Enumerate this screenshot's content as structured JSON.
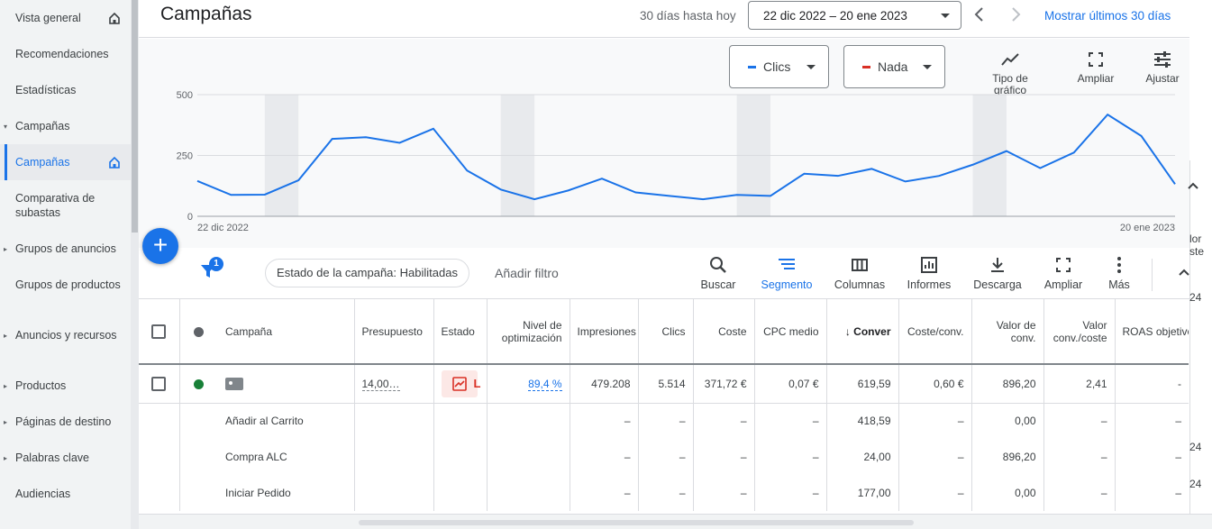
{
  "sidebar": {
    "items": [
      {
        "label": "Vista general",
        "caret": false,
        "home": true,
        "active": false
      },
      {
        "label": "Recomendaciones",
        "caret": false,
        "home": false,
        "active": false
      },
      {
        "label": "Estadísticas",
        "caret": false,
        "home": false,
        "active": false
      },
      {
        "label": "Campañas",
        "caret": true,
        "caret_open": true,
        "home": false,
        "active": false
      },
      {
        "label": "Campañas",
        "caret": false,
        "home": true,
        "active": true
      },
      {
        "label": "Comparativa de subastas",
        "caret": false,
        "home": false,
        "active": false
      },
      {
        "label": "Grupos de anuncios",
        "caret": true,
        "home": false,
        "active": false
      },
      {
        "label": "Grupos de productos",
        "caret": false,
        "home": false,
        "active": false
      },
      {
        "label": "Anuncios y recursos",
        "caret": true,
        "home": false,
        "active": false
      },
      {
        "label": "Productos",
        "caret": true,
        "home": false,
        "active": false
      },
      {
        "label": "Páginas de destino",
        "caret": true,
        "home": false,
        "active": false
      },
      {
        "label": "Palabras clave",
        "caret": true,
        "home": false,
        "active": false
      },
      {
        "label": "Audiencias",
        "caret": false,
        "home": false,
        "active": false
      }
    ]
  },
  "header": {
    "title": "Campañas",
    "date_prefix": "30 días hasta hoy",
    "date_range": "22 dic 2022 – 20 ene 2023",
    "show_last": "Mostrar últimos 30 días",
    "show_last_clip": "g"
  },
  "chart_controls": {
    "metric1": "Clics",
    "metric1_color": "#1a73e8",
    "metric2": "Nada",
    "metric2_color": "#d93025",
    "chart_type_label": "Tipo de gráfico",
    "expand_label": "Ampliar",
    "adjust_label": "Ajustar"
  },
  "chart_data": {
    "type": "line",
    "x_start_label": "22 dic 2022",
    "x_end_label": "20 ene 2023",
    "y_ticks": [
      "500",
      "250",
      "0"
    ],
    "ylim": [
      0,
      500
    ],
    "grid": true,
    "weekend_bands": true,
    "series": [
      {
        "color": "#1a73e8",
        "values": [
          145,
          88,
          89,
          148,
          318,
          325,
          302,
          360,
          188,
          110,
          70,
          106,
          155,
          98,
          84,
          70,
          88,
          84,
          175,
          166,
          195,
          143,
          166,
          212,
          268,
          198,
          262,
          418,
          330,
          132
        ]
      }
    ]
  },
  "filter_bar": {
    "fab_label": "+",
    "filter_count": "1",
    "status_chip": "Estado de la campaña: Habilitadas",
    "add_filter": "Añadir filtro",
    "tools": [
      {
        "label": "Buscar",
        "icon": "search-icon",
        "active": false
      },
      {
        "label": "Segmento",
        "icon": "segment-icon",
        "active": true
      },
      {
        "label": "Columnas",
        "icon": "columns-icon",
        "active": false
      },
      {
        "label": "Informes",
        "icon": "reports-icon",
        "active": false
      },
      {
        "label": "Descarga",
        "icon": "download-icon",
        "active": false
      },
      {
        "label": "Ampliar",
        "icon": "expand-icon",
        "active": false
      },
      {
        "label": "Más",
        "icon": "more-icon",
        "active": false
      }
    ]
  },
  "table": {
    "headers": [
      "Campaña",
      "Presupuesto",
      "Estado",
      "Nivel de optimización",
      "Impresiones",
      "Clics",
      "Coste",
      "CPC medio",
      "Conver",
      "Coste/conv.",
      "Valor de conv.",
      "Valor conv./coste",
      "ROAS objetivo"
    ],
    "sort_arrow": "↓",
    "main_row": {
      "budget": "14,00…",
      "status_letter": "L",
      "opt": "89,4 %",
      "impressions": "479.208",
      "clicks": "5.514",
      "cost": "371,72 €",
      "cpc": "0,07 €",
      "conv": "619,59",
      "cost_conv": "0,60 €",
      "conv_value": "896,20",
      "value_cost": "2,41",
      "roas": "-"
    },
    "segment_rows": [
      {
        "name": "Añadir al Carrito",
        "impressions": "–",
        "clicks": "–",
        "cost": "–",
        "cpc": "–",
        "conv": "418,59",
        "cost_conv": "–",
        "conv_value": "0,00",
        "value_cost": "–",
        "roas": "–"
      },
      {
        "name": "Compra ALC",
        "impressions": "–",
        "clicks": "–",
        "cost": "–",
        "cpc": "–",
        "conv": "24,00",
        "cost_conv": "–",
        "conv_value": "896,20",
        "value_cost": "–",
        "roas": "–"
      },
      {
        "name": "Iniciar Pedido",
        "impressions": "–",
        "clicks": "–",
        "cost": "–",
        "cpc": "–",
        "conv": "177,00",
        "cost_conv": "–",
        "conv_value": "0,00",
        "value_cost": "–",
        "roas": "–"
      }
    ]
  },
  "right_edge": {
    "frag1": "lor",
    "frag2": "ste",
    "frag3": "24",
    "frag4": "24",
    "frag5": "24"
  }
}
